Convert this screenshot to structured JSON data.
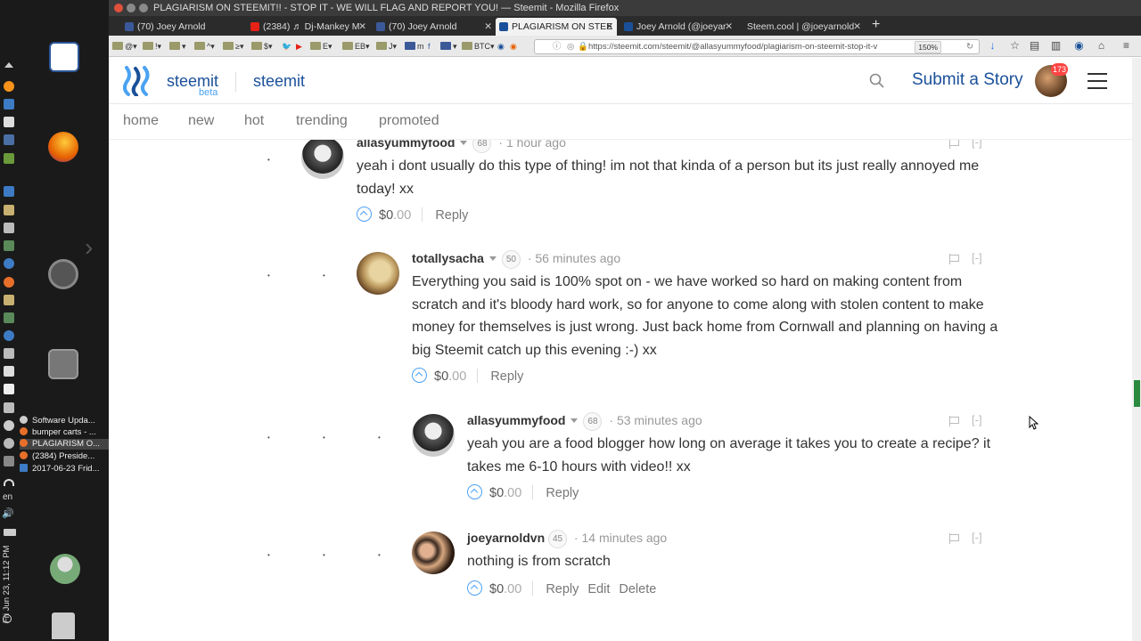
{
  "system": {
    "tasks": [
      "Software Upda...",
      "bumper carts - ...",
      "PLAGIARISM O...",
      "(2384) Preside...",
      "2017-06-23 Frid..."
    ],
    "lang": "en",
    "clock": "Fri Jun 23, 11:12 PM"
  },
  "window": {
    "title": "PLAGIARISM ON STEEMIT!! - STOP IT - WE WILL FLAG AND REPORT YOU! — Steemit - Mozilla Firefox"
  },
  "tabs": [
    {
      "label": "(70) Joey Arnold",
      "color": "#3b5998"
    },
    {
      "label": "(2384) ♬ Dj-Mankey M",
      "color": "#e62117"
    },
    {
      "label": "(70) Joey Arnold",
      "color": "#3b5998"
    },
    {
      "label": "PLAGIARISM ON STEE",
      "color": "#1a5099"
    },
    {
      "label": "Joey Arnold (@joeyar",
      "color": "#1a5099"
    },
    {
      "label": "Steem.cool | @joeyarnold",
      "color": "#888888"
    }
  ],
  "bookmarks": [
    "@",
    "!",
    "^",
    "≥",
    "$",
    "E",
    "EB",
    "J",
    "m",
    "BTC"
  ],
  "urlbar": {
    "url": "https://steemit.com/steemit/@allasyummyfood/plagiarism-on-steemit-stop-it-v",
    "zoom": "150%"
  },
  "header": {
    "brand": "steemit",
    "beta": "beta",
    "community": "steemit",
    "submit": "Submit a Story",
    "notifications": "173"
  },
  "subnav": [
    "home",
    "new",
    "hot",
    "trending",
    "promoted"
  ],
  "comments": [
    {
      "author": "allasyummyfood",
      "rep": "68",
      "time": "1 hour ago",
      "body": "yeah i dont usually do this type of thing! im not that kinda of a person but its just really annoyed me today! xx",
      "payout_int": "$0",
      "payout_dec": ".00",
      "actions": [
        "Reply"
      ]
    },
    {
      "author": "totallysacha",
      "rep": "50",
      "time": "56 minutes ago",
      "body": "Everything you said is 100% spot on - we have worked so hard on making content from scratch and it's bloody hard work, so for anyone to come along with stolen content to make money for themselves is just wrong. Just back home from Cornwall and planning on having a big Steemit catch up this evening :-) xx",
      "payout_int": "$0",
      "payout_dec": ".00",
      "actions": [
        "Reply"
      ]
    },
    {
      "author": "allasyummyfood",
      "rep": "68",
      "time": "53 minutes ago",
      "body": "yeah you are a food blogger how long on average it takes you to create a recipe? it takes me 6-10 hours with video!! xx",
      "payout_int": "$0",
      "payout_dec": ".00",
      "actions": [
        "Reply"
      ]
    },
    {
      "author": "joeyarnoldvn",
      "rep": "45",
      "time": "14 minutes ago",
      "body": "nothing is from scratch",
      "payout_int": "$0",
      "payout_dec": ".00",
      "actions": [
        "Reply",
        "Edit",
        "Delete"
      ]
    }
  ],
  "collapse_label": "[-]",
  "separator": "·"
}
